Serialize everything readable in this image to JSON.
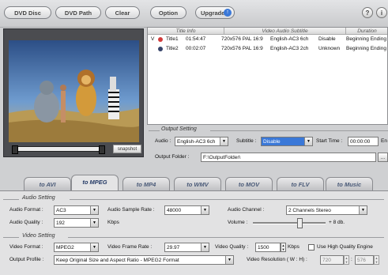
{
  "toolbar": {
    "dvd_disc": "DVD Disc",
    "dvd_path": "DVD Path",
    "clear": "Clear",
    "option": "Option",
    "upgrade": "Upgrade",
    "help": "?",
    "about": "i"
  },
  "preview": {
    "snapshot": "snapshot"
  },
  "titles": {
    "headers": [
      "Title Info",
      "Video Audio Subtitle",
      "Duration"
    ],
    "rows": [
      {
        "check": "V",
        "name": "Title1",
        "time": "01:54:47",
        "video": "720x576 PAL 16:9",
        "audio": "English-AC3 6ch",
        "subtitle": "Disable",
        "duration": "Beginning Ending"
      },
      {
        "check": "",
        "name": "Title2",
        "time": "00:02:07",
        "video": "720x576 PAL 16:9",
        "audio": "English-AC3 2ch",
        "subtitle": "Unknown",
        "duration": "Beginning Ending"
      }
    ]
  },
  "output_setting": {
    "section": "Output Setting",
    "audio_label": "Audio :",
    "audio_value": "English-AC3 6ch",
    "subtitle_label": "Subtitle :",
    "subtitle_value": "Disable",
    "start_label": "Start Time :",
    "start_value": "00:00:00",
    "end_label": "En",
    "folder_label": "Output Folder :",
    "folder_value": "F:\\OutputFolder\\",
    "folder_btn": "..."
  },
  "tabs": [
    "to AVI",
    "to MPEG",
    "to MP4",
    "to WMV",
    "to MOV",
    "to FLV",
    "to Music"
  ],
  "active_tab": 1,
  "audio_setting": {
    "section": "Audio Setting",
    "format_label": "Audio Format :",
    "format_value": "AC3",
    "sample_label": "Audio Sample Rate :",
    "sample_value": "48000",
    "channel_label": "Audio Channel :",
    "channel_value": "2 Channels Stereo",
    "quality_label": "Audio Quality :",
    "quality_value": "192",
    "quality_unit": "Kbps",
    "volume_label": "Volume :",
    "volume_value": "+ 8 db."
  },
  "video_setting": {
    "section": "Video Setting",
    "format_label": "Video Format :",
    "format_value": "MPEG2",
    "framerate_label": "Video Frame Rate :",
    "framerate_value": "29.97",
    "quality_label": "Video Quality :",
    "quality_value": "1500",
    "quality_unit": "Kbps",
    "hq_label": "Use High Quality Engine",
    "profile_label": "Output Profile :",
    "profile_value": "Keep Original Size and Aspect Ratio - MPEG2 Format",
    "resolution_label": "Video Resolution ( W : H) :",
    "res_w": "720",
    "res_h": "576"
  },
  "colors": {
    "accent": "#3a78d8",
    "toolbar": "#d6d7d9",
    "panel": "#e2e2e3"
  }
}
